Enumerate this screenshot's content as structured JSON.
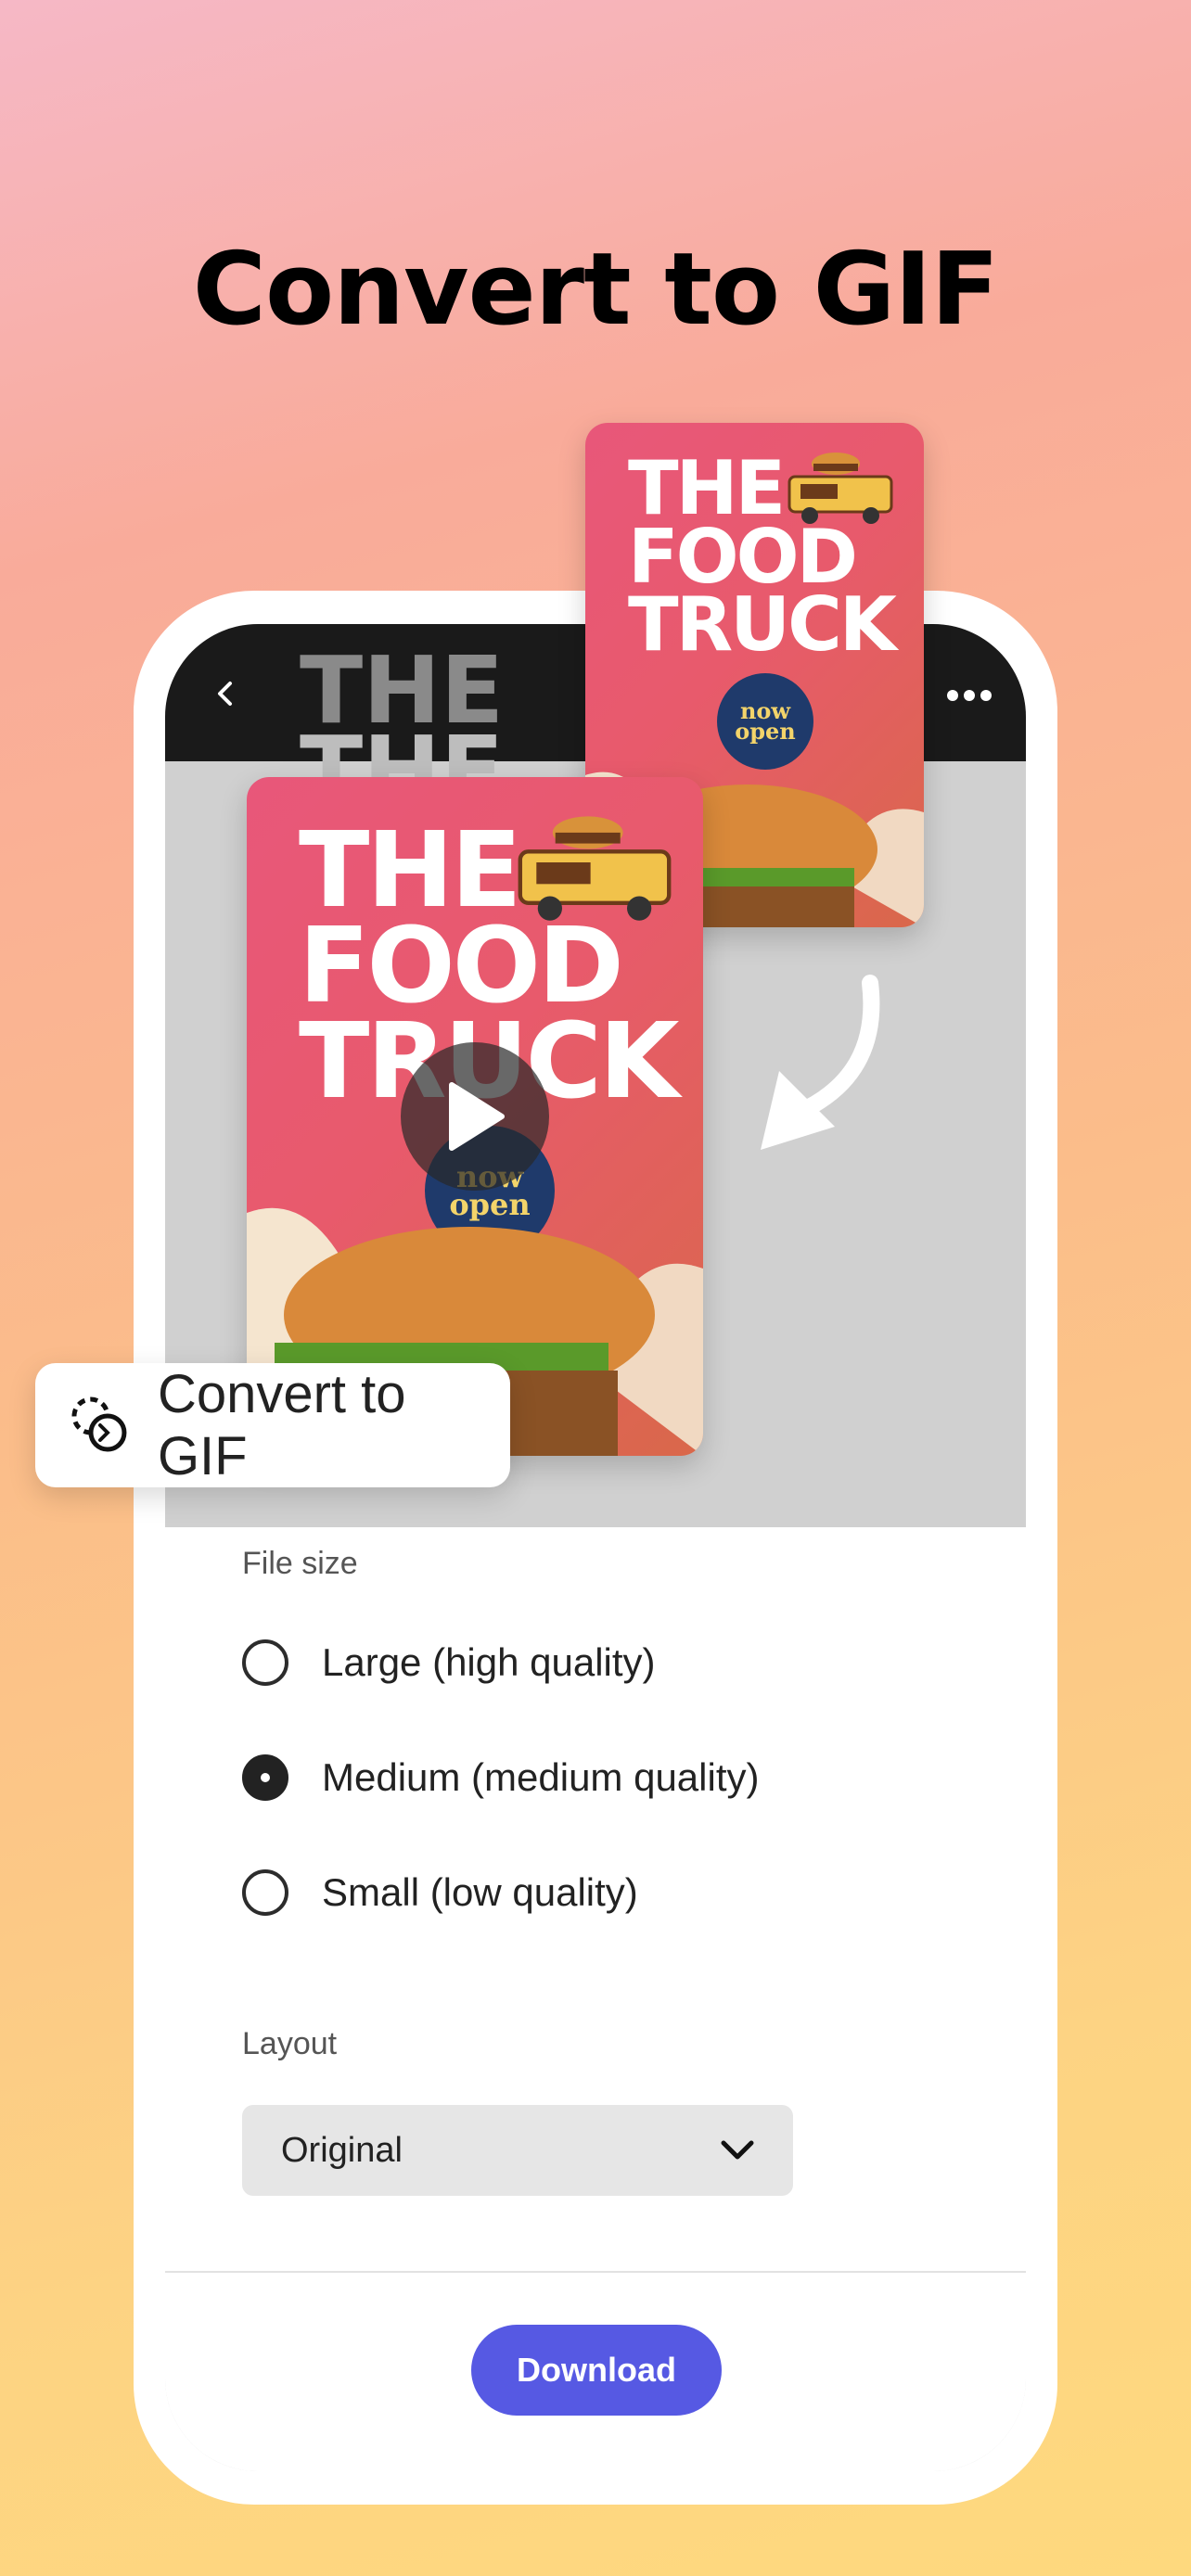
{
  "headline": "Convert to GIF",
  "poster": {
    "title_line1": "THE",
    "title_line2": "FOOD",
    "title_line3": "TRUCK",
    "badge_line1": "now",
    "badge_line2": "open"
  },
  "chip": {
    "label": "Convert to GIF",
    "icon": "convert-gif-icon"
  },
  "settings": {
    "file_size_label": "File size",
    "options": [
      {
        "label": "Large (high quality)",
        "selected": false
      },
      {
        "label": "Medium (medium quality)",
        "selected": true
      },
      {
        "label": "Small (low quality)",
        "selected": false
      }
    ],
    "layout_label": "Layout",
    "layout_value": "Original",
    "download_label": "Download"
  },
  "colors": {
    "accent": "#5659e3",
    "poster_pink": "#e8577a",
    "poster_orange": "#d9684a"
  }
}
